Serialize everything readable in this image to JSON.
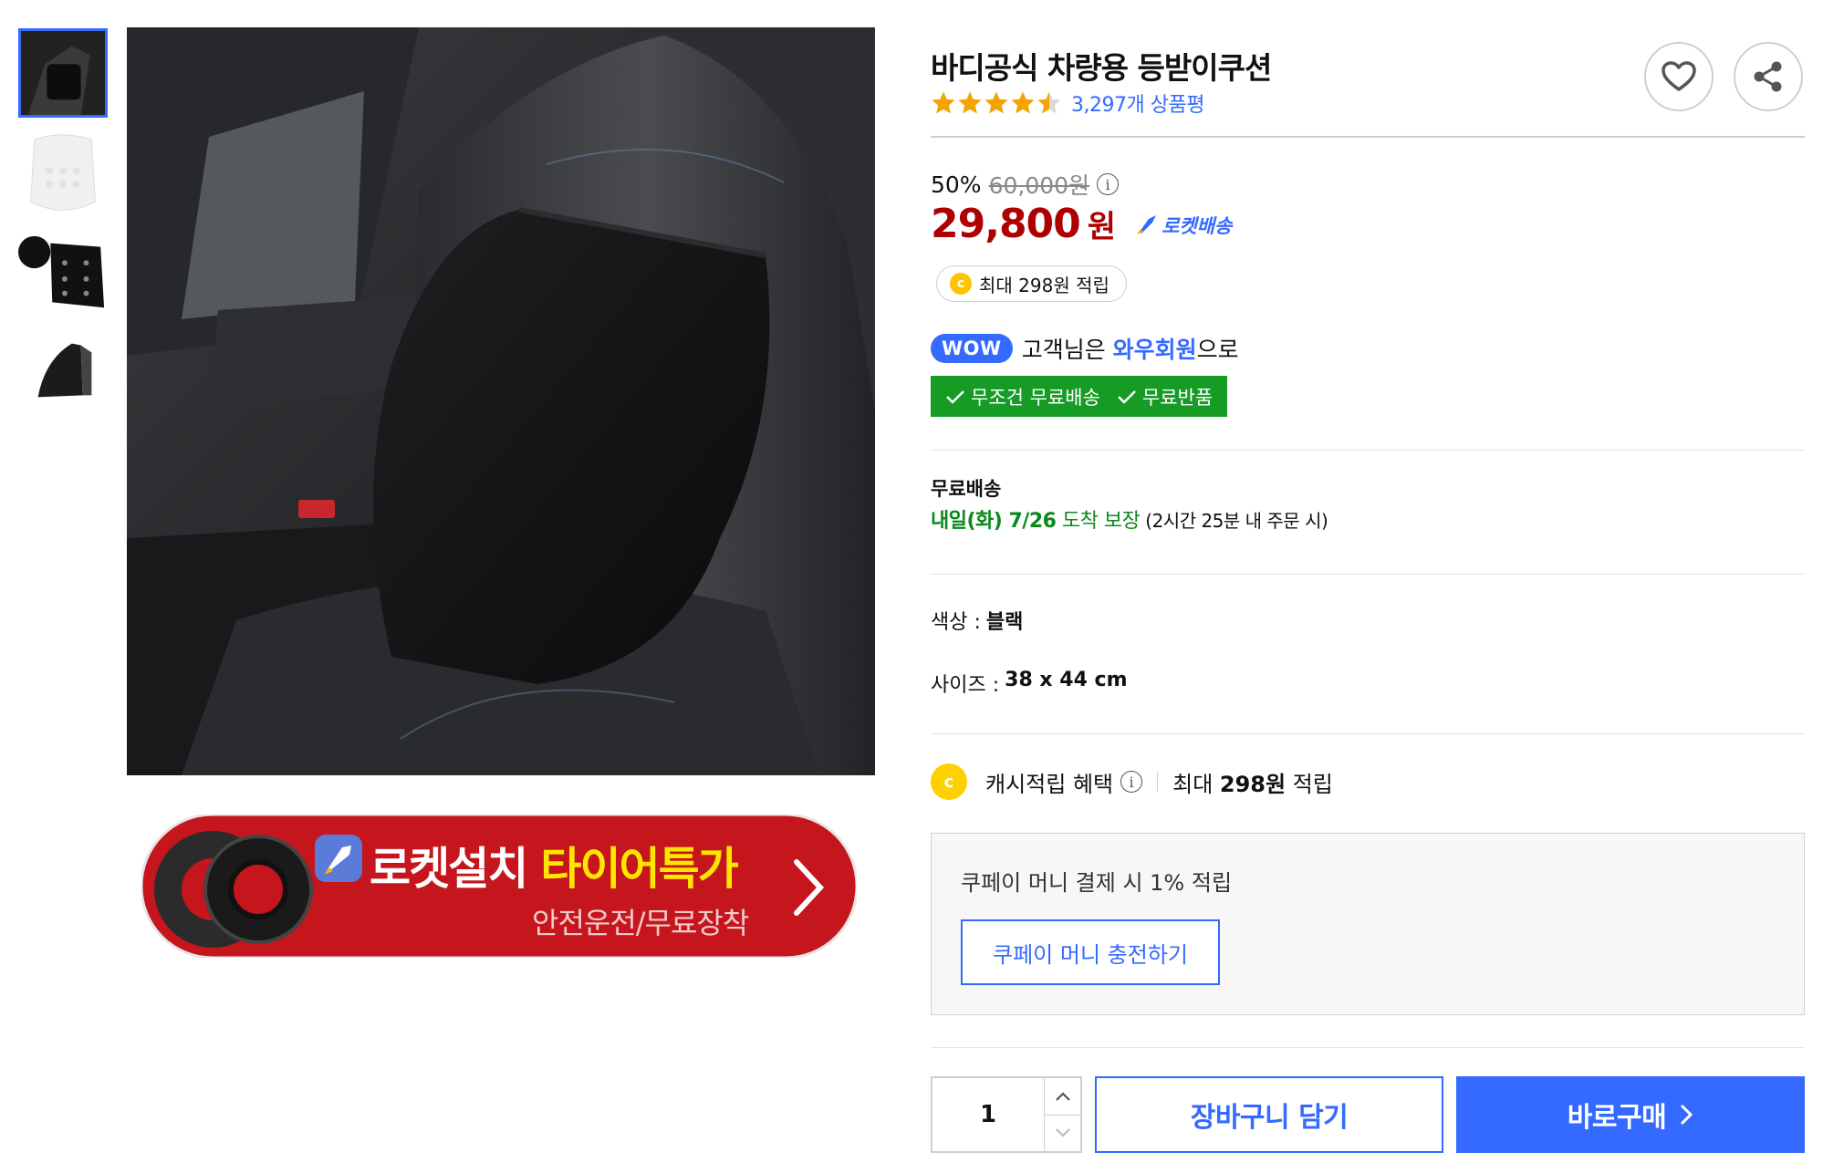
{
  "product": {
    "title": "바디공식 차량용 등받이쿠션",
    "rating": 4.5,
    "review_count": "3,297개 상품평"
  },
  "actions": {
    "wishlist_icon": "heart-icon",
    "share_icon": "share-icon"
  },
  "price": {
    "discount_rate": "50%",
    "original_price": "60,000원",
    "sale_price": "29,800",
    "sale_unit": "원",
    "rocket_label": "로켓배송",
    "cash_reward": "최대 298원 적립",
    "coin_letter": "c"
  },
  "wow": {
    "badge": "WOW",
    "text_before": "고객님은 ",
    "member": "와우회원",
    "text_after": "으로",
    "benefit_1": "무조건 무료배송",
    "benefit_2": "무료반품"
  },
  "shipping": {
    "label": "무료배송",
    "eta_date": "내일(화) 7/26",
    "eta_guarantee": " 도착 보장",
    "eta_note": " (2시간 25분 내 주문 시)"
  },
  "options": {
    "color_label": "색상 :",
    "color_value": "블랙",
    "size_label": "사이즈 :",
    "size_value": "38 x 44 cm"
  },
  "cashback": {
    "label": "캐시적립 혜택",
    "prefix": "최대 ",
    "amount": "298원",
    "suffix": " 적립"
  },
  "coupay": {
    "text": "쿠페이 머니 결제 시 1% 적립",
    "button": "쿠페이 머니 충전하기"
  },
  "purchase": {
    "quantity": "1",
    "cart_button": "장바구니 담기",
    "buy_button": "바로구매"
  },
  "banner": {
    "title_white": "로켓설치 ",
    "title_yellow": "타이어특가",
    "subtitle": "안전운전/무료장착"
  },
  "colors": {
    "accent_blue": "#346aff",
    "price_red": "#ae0000",
    "wow_green": "#169b25",
    "eta_green": "#0b8a1c",
    "star_orange": "#f5a300",
    "banner_red": "#c4161c"
  }
}
